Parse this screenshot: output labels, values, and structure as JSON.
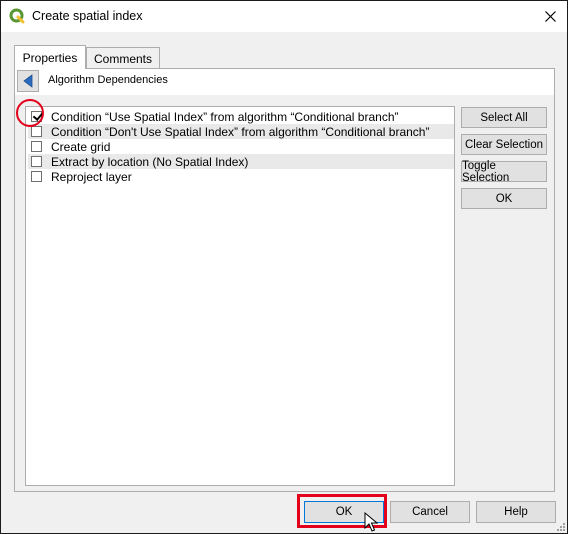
{
  "window": {
    "title": "Create spatial index",
    "colors": {
      "qgis_green": "#589632",
      "highlight_red": "#e3001b",
      "accent_blue": "#0078d7"
    }
  },
  "tabs": [
    {
      "label": "Properties",
      "active": true
    },
    {
      "label": "Comments",
      "active": false
    }
  ],
  "panel": {
    "back_icon": "back-arrow-icon",
    "title": "Algorithm Dependencies"
  },
  "list": {
    "items": [
      {
        "label": "Condition “Use Spatial Index” from algorithm “Conditional branch”",
        "checked": true
      },
      {
        "label": "Condition “Don't Use Spatial Index” from algorithm “Conditional branch”",
        "checked": false
      },
      {
        "label": "Create grid",
        "checked": false
      },
      {
        "label": "Extract by location (No Spatial Index)",
        "checked": false
      },
      {
        "label": "Reproject layer",
        "checked": false
      }
    ]
  },
  "side_buttons": {
    "select_all": "Select All",
    "clear_selection": "Clear Selection",
    "toggle_selection": "Toggle Selection",
    "ok": "OK"
  },
  "bottom_buttons": {
    "ok": "OK",
    "cancel": "Cancel",
    "help": "Help"
  }
}
